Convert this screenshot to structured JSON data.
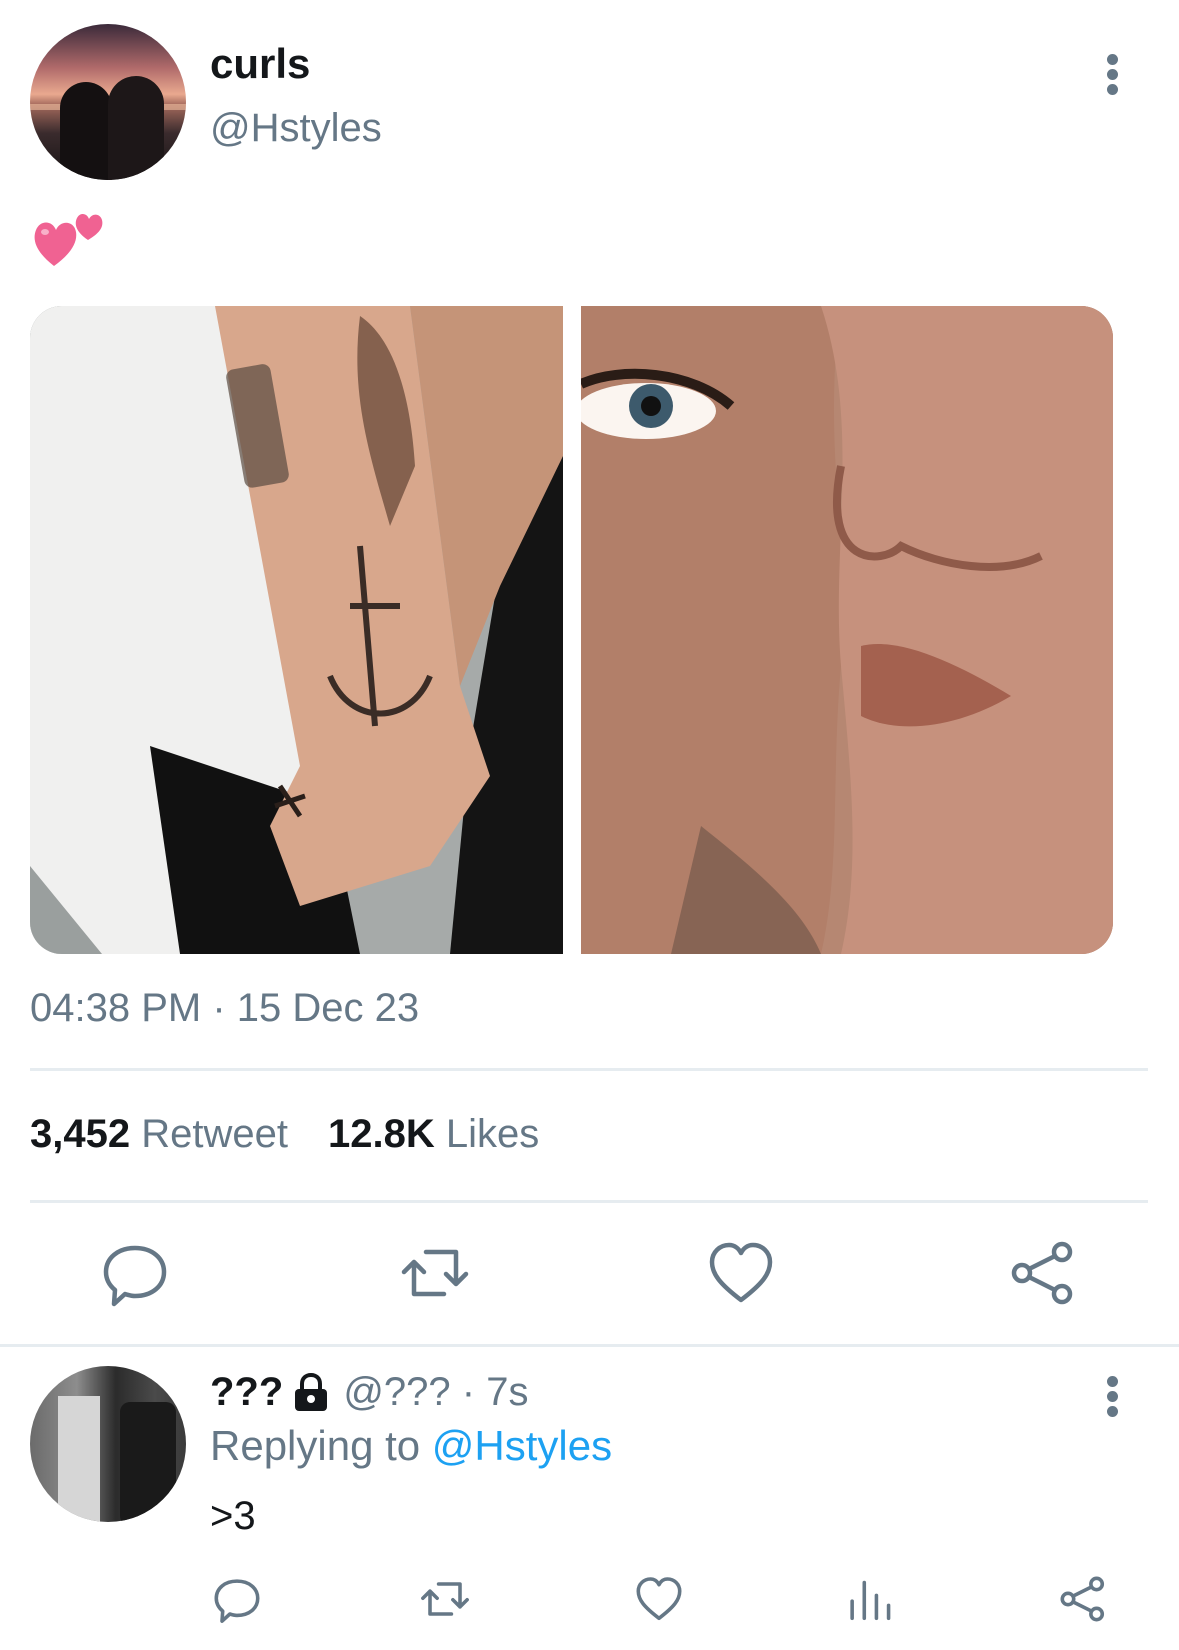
{
  "tweet": {
    "display_name": "curls",
    "handle": "@Hstyles",
    "text_emoji": "two-hearts-emoji",
    "timestamp": "04:38 PM · 15 Dec 23",
    "retweet_count": "3,452",
    "retweet_label": "Retweet",
    "likes_count": "12.8K",
    "likes_label": "Likes"
  },
  "actions": [
    "reply-icon",
    "retweet-icon",
    "like-icon",
    "share-icon"
  ],
  "reply": {
    "display_name": "???",
    "handle_time": "@??? · 7s",
    "replying_prefix": "Replying to",
    "replying_mention": "@Hstyles",
    "text": ">3",
    "actions": [
      "reply-icon",
      "retweet-icon",
      "like-icon",
      "analytics-icon",
      "share-icon"
    ]
  },
  "colors": {
    "primary_text": "#14171a",
    "secondary_text": "#657786",
    "link": "#1da1f2",
    "heart_emoji": "#f06292",
    "divider": "#e6ecf0"
  }
}
